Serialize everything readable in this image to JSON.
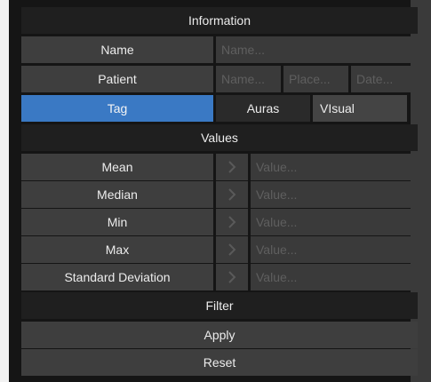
{
  "information": {
    "title": "Information"
  },
  "name": {
    "label": "Name",
    "placeholder": "Name..."
  },
  "patient": {
    "label": "Patient",
    "name_placeholder": "Name...",
    "place_placeholder": "Place...",
    "date_placeholder": "Date..."
  },
  "tabs": {
    "tag": "Tag",
    "auras": "Auras",
    "visual": "VIsual"
  },
  "values": {
    "title": "Values",
    "rows": [
      {
        "label": "Mean",
        "placeholder": "Value..."
      },
      {
        "label": "Median",
        "placeholder": "Value..."
      },
      {
        "label": "Min",
        "placeholder": "Value..."
      },
      {
        "label": "Max",
        "placeholder": "Value..."
      },
      {
        "label": "Standard Deviation",
        "placeholder": "Value..."
      }
    ]
  },
  "filter": {
    "title": "Filter",
    "apply": "Apply",
    "reset": "Reset"
  },
  "colors": {
    "accent": "#3a79c4",
    "background": "#151515",
    "button": "#3e3e3e"
  },
  "icons": {
    "row_arrow": "chevron-right-icon"
  }
}
